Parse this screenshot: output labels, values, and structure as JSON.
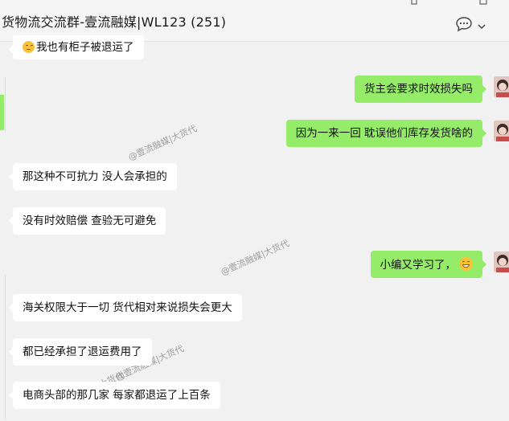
{
  "header": {
    "title": "货物流交流群-壹流融媒|WL123 (251)",
    "chat_info_icon": "speech-bubble-icon",
    "more_icon": "chevron-down-icon"
  },
  "messages": [
    {
      "side": "in",
      "text": "我也有柜子被退运了",
      "emoji": "sad-face-icon"
    },
    {
      "side": "out",
      "text": "货主会要求时效损失吗"
    },
    {
      "side": "out",
      "text": "因为一来一回 耽误他们库存发货啥的"
    },
    {
      "side": "in",
      "text": "那这种不可抗力  没人会承担的"
    },
    {
      "side": "in",
      "text": "没有时效赔偿    查验无可避免"
    },
    {
      "side": "out",
      "text": "小编又学习了，",
      "emoji": "grinning-face-icon"
    },
    {
      "side": "in",
      "text": "海关权限大于一切   货代相对来说损失会更大"
    },
    {
      "side": "in",
      "text": "都已经承担了退运费用了"
    },
    {
      "side": "in",
      "text": "电商头部的那几家 每家都退运了上百条"
    }
  ],
  "watermarks": [
    "@壹流融媒|大货代",
    "@壹流融媒|大货代",
    "@壹流融媒|大货代",
    "@壹流融媒|大货代"
  ],
  "colors": {
    "outgoing_bubble": "#95ec69",
    "incoming_bubble": "#ffffff",
    "background": "#f1f1f1"
  }
}
